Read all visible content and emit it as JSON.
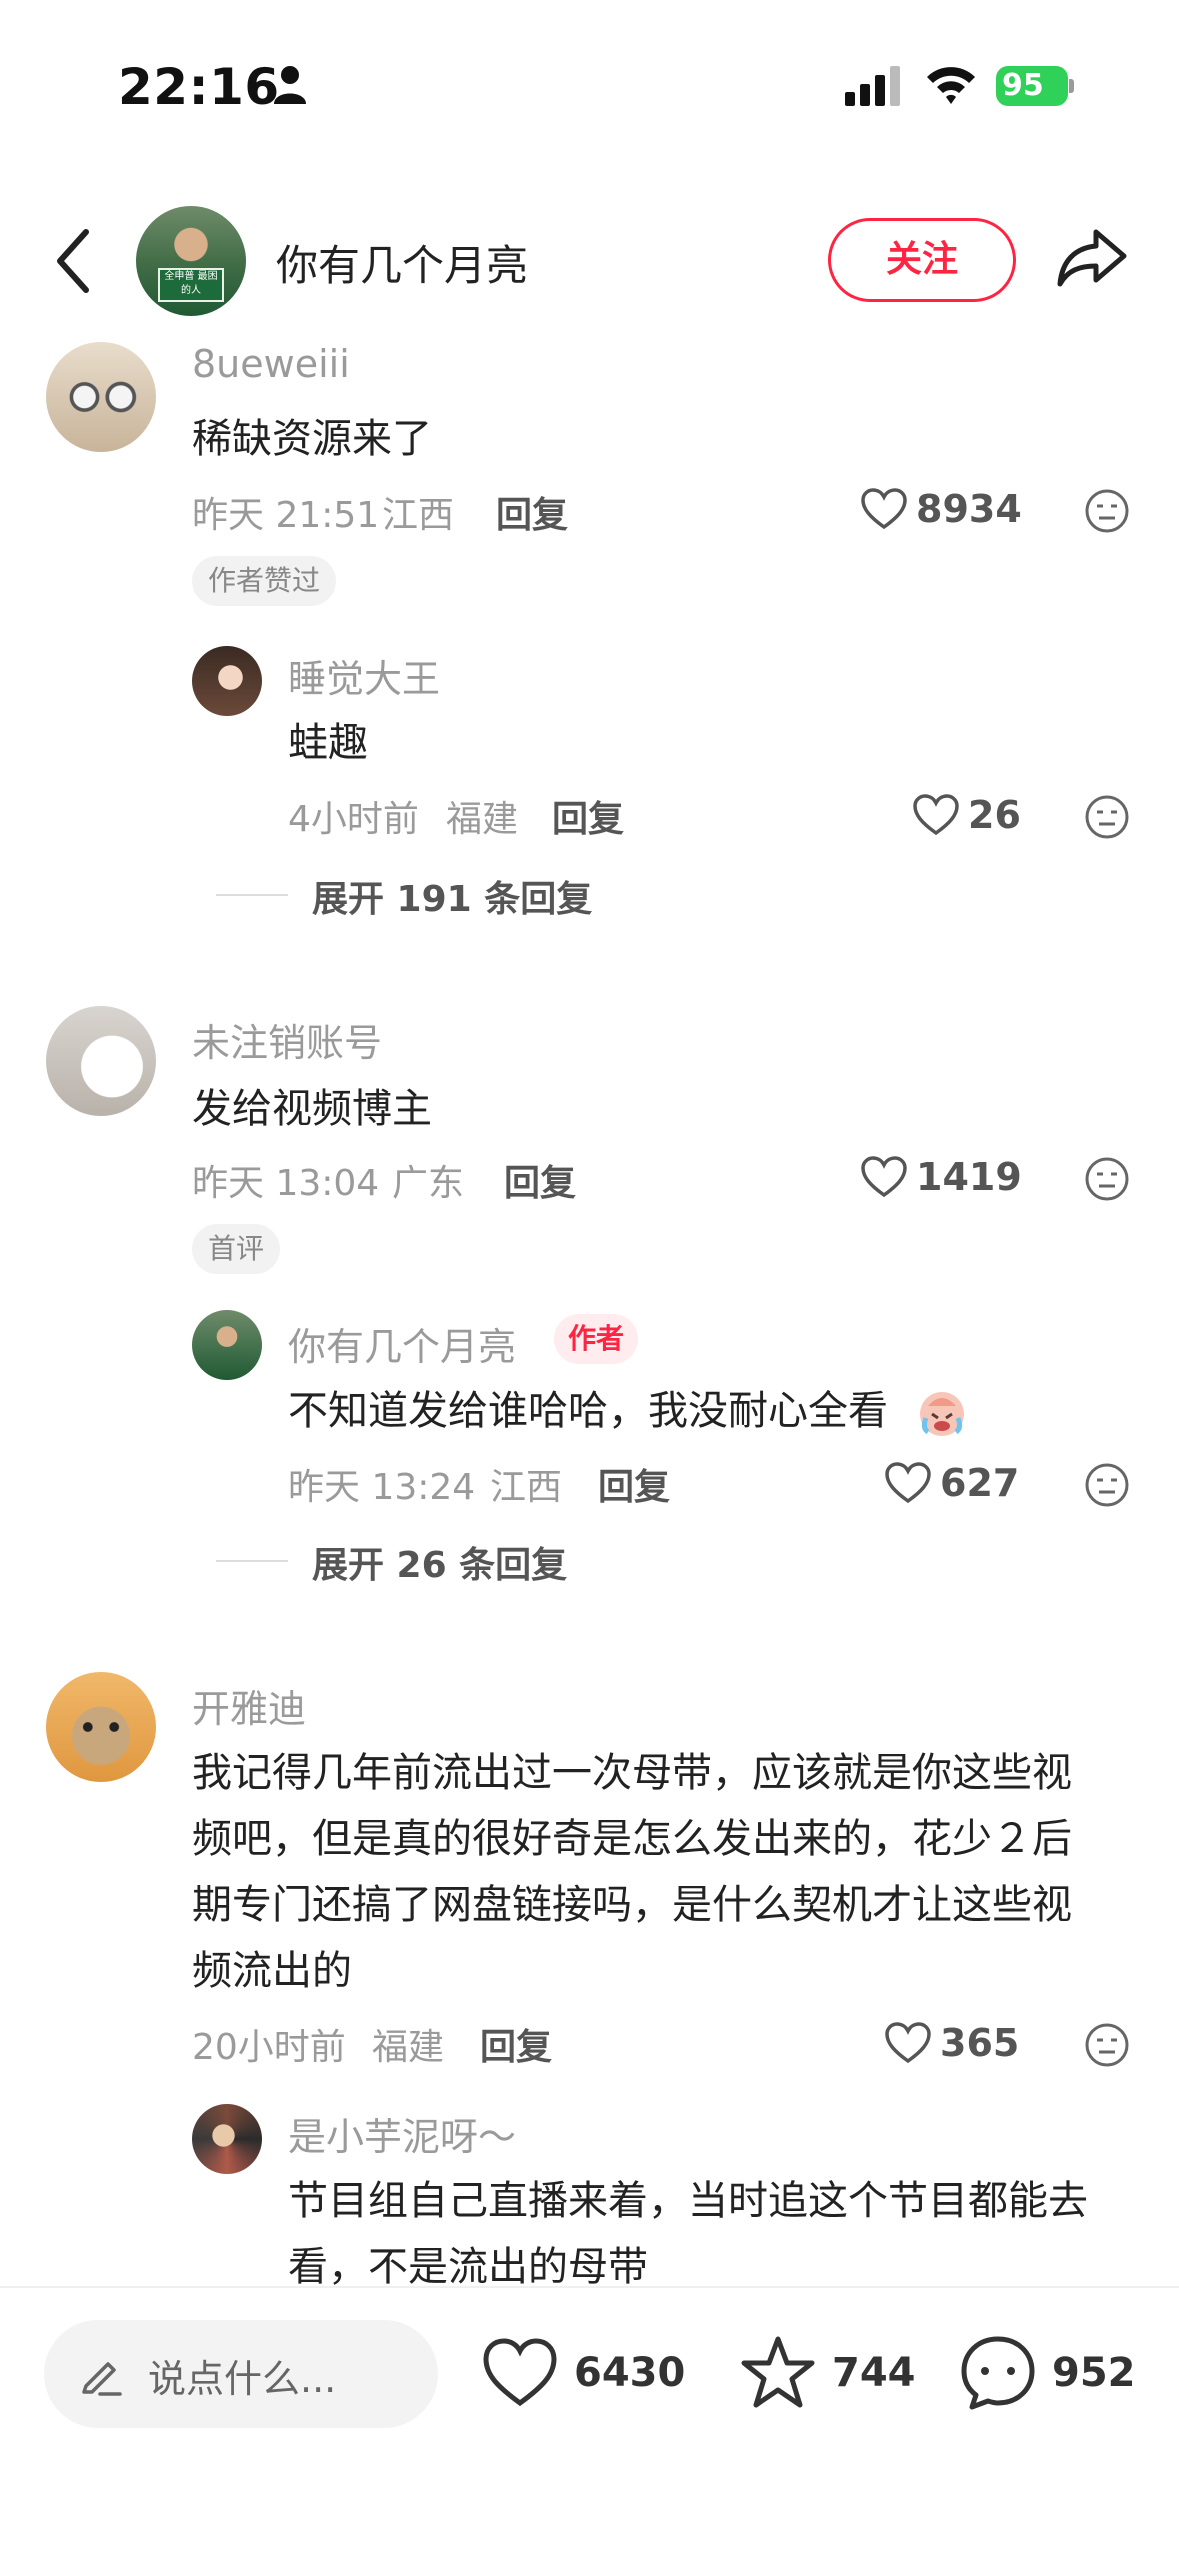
{
  "status_bar": {
    "time": "22:16",
    "battery": "95"
  },
  "header": {
    "title": "你有几个月亮",
    "follow_label": "关注",
    "avatar_tag": "全申普 最困的人"
  },
  "comments": [
    {
      "username": "8ueweiii",
      "text": "稀缺资源来了",
      "time": "昨天 21:51",
      "location": "江西",
      "reply_label": "回复",
      "likes": "8934",
      "badge": "作者赞过",
      "reply": {
        "username": "睡觉大王",
        "text": "蛙趣",
        "time": "4小时前",
        "location": "福建",
        "reply_label": "回复",
        "likes": "26"
      },
      "expand_label": "展开 191 条回复"
    },
    {
      "username": "未注销账号",
      "text": "发给视频博主",
      "time": "昨天 13:04",
      "location": "广东",
      "reply_label": "回复",
      "likes": "1419",
      "badge": "首评",
      "reply": {
        "username": "你有几个月亮",
        "author_badge": "作者",
        "text": "不知道发给谁哈哈，我没耐心全看",
        "time": "昨天 13:24",
        "location": "江西",
        "reply_label": "回复",
        "likes": "627"
      },
      "expand_label": "展开 26 条回复"
    },
    {
      "username": "开雅迪",
      "lines": [
        "我记得几年前流出过一次母带，应该就是你这些视",
        "频吧，但是真的很好奇是怎么发出来的，花少２后",
        "期专门还搞了网盘链接吗，是什么契机才让这些视",
        "频流出的"
      ],
      "time": "20小时前",
      "location": "福建",
      "reply_label": "回复",
      "likes": "365",
      "reply": {
        "username": "是小芋泥呀～",
        "lines": [
          "节目组自己直播来着，当时追这个节目都能去",
          "看，不是流出的母带"
        ]
      }
    }
  ],
  "bottom_bar": {
    "placeholder": "说点什么...",
    "likes": "6430",
    "favorites": "744",
    "comments": "952"
  }
}
